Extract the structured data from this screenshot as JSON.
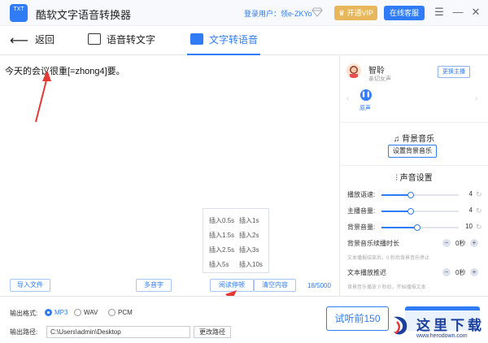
{
  "app": {
    "logo_text": "TXT",
    "title": "酷软文字语音转换器",
    "login_user": "登录用户：领e-ZKYo",
    "vip_label": "开通VIP",
    "support_label": "在线客服"
  },
  "tabs": {
    "back": "返回",
    "speech_to_text": "语音转文字",
    "text_to_speech": "文字转语音"
  },
  "editor": {
    "content": "今天的会议很重[=zhong4]要。",
    "counter": "18/5000",
    "pauses": [
      "插入0.5s",
      "插入1s",
      "插入1.5s",
      "插入2s",
      "插入2.5s",
      "插入3s",
      "插入5s",
      "插入10s"
    ],
    "buttons": {
      "import": "导入文件",
      "polyphone": "多音字",
      "read_pause": "阅读停顿",
      "clear": "清空内容"
    }
  },
  "voice": {
    "name": "智聆",
    "description": "亲切女声",
    "change_label": "更换主播",
    "original_label": "原声"
  },
  "bgm": {
    "title": "背景音乐",
    "set_label": "设置背景音乐"
  },
  "settings": {
    "title": "声音设置",
    "sliders": [
      {
        "label": "播放语速:",
        "value": "4",
        "fraction": 0.38
      },
      {
        "label": "主播音量:",
        "value": "4",
        "fraction": 0.38
      },
      {
        "label": "背景音量:",
        "value": "10",
        "fraction": 0.46
      }
    ],
    "bg_extend": {
      "label": "背景音乐续播时长",
      "value": "0秒",
      "note": "文本播报结束后，0 秒后背景音乐停止"
    },
    "text_delay": {
      "label": "文本播放推迟",
      "value": "0秒",
      "note": "背景音乐播放 0 秒后，开始播报文本"
    }
  },
  "output": {
    "format_label": "输出格式:",
    "formats": [
      "MP3",
      "WAV",
      "PCM"
    ],
    "selected_format": "MP3",
    "path_label": "输出路径:",
    "path_value": "C:\\Users\\admin\\Desktop",
    "change_path_label": "更改路径",
    "preview_label": "试听前150"
  },
  "watermark": {
    "cn": "这里下载",
    "url": "www.herodown.com"
  },
  "colors": {
    "accent": "#2f7cf6",
    "vip": "#e9b75b",
    "annotation": "#e53935"
  }
}
